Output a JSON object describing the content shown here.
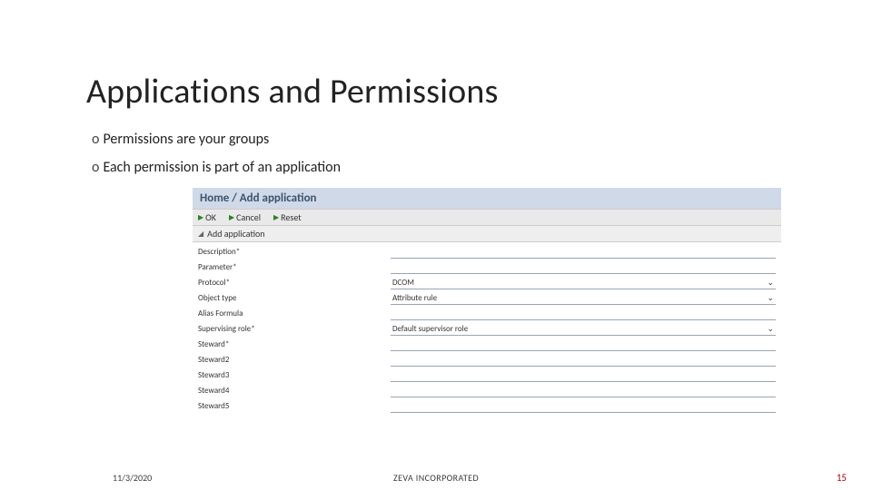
{
  "slide": {
    "title": "Applications and Permissions",
    "bullets": [
      "Permissions are your groups",
      "Each permission is part of an application"
    ]
  },
  "app": {
    "breadcrumb": "Home / Add application",
    "toolbar": {
      "ok": "OK",
      "cancel": "Cancel",
      "reset": "Reset"
    },
    "section_title": "Add application",
    "fields": {
      "description": {
        "label": "Description*",
        "value": ""
      },
      "parameter": {
        "label": "Parameter*",
        "value": ""
      },
      "protocol": {
        "label": "Protocol*",
        "value": "DCOM"
      },
      "object_type": {
        "label": "Object type",
        "value": "Attribute rule"
      },
      "alias": {
        "label": "Alias Formula",
        "value": ""
      },
      "supervising": {
        "label": "Supervising role*",
        "value": "Default supervisor role"
      },
      "steward1": {
        "label": "Steward*",
        "value": ""
      },
      "steward2": {
        "label": "Steward2",
        "value": ""
      },
      "steward3": {
        "label": "Steward3",
        "value": ""
      },
      "steward4": {
        "label": "Steward4",
        "value": ""
      },
      "steward5": {
        "label": "Steward5",
        "value": ""
      }
    }
  },
  "footer": {
    "date": "11/3/2020",
    "company": "ZEVA INCORPORATED",
    "page": "15"
  }
}
